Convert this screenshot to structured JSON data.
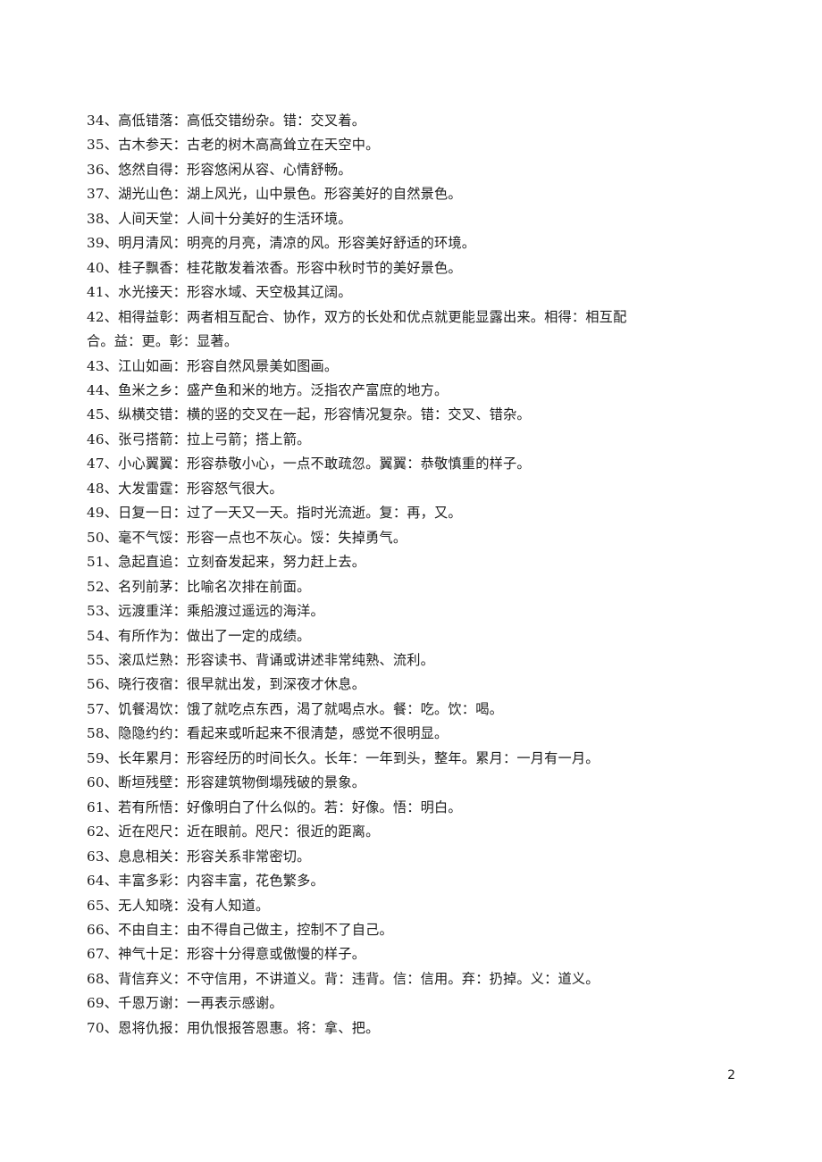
{
  "document": {
    "page_number": "2",
    "entries": [
      {
        "text": "34、高低错落：高低交错纷杂。错：交叉着。"
      },
      {
        "text": "35、古木参天：古老的树木高高耸立在天空中。"
      },
      {
        "text": "36、悠然自得：形容悠闲从容、心情舒畅。"
      },
      {
        "text": "37、湖光山色：湖上风光，山中景色。形容美好的自然景色。"
      },
      {
        "text": "38、人间天堂：人间十分美好的生活环境。"
      },
      {
        "text": "39、明月清风：明亮的月亮，清凉的风。形容美好舒适的环境。"
      },
      {
        "text": "40、桂子飘香：桂花散发着浓香。形容中秋时节的美好景色。"
      },
      {
        "text": "41、水光接天：形容水域、天空极其辽阔。"
      },
      {
        "text": "42、相得益彰：两者相互配合、协作，双方的长处和优点就更能显露出来。相得：相互配"
      },
      {
        "text": "合。益：更。彰：显著。",
        "wrapped": true
      },
      {
        "text": "43、江山如画：形容自然风景美如图画。"
      },
      {
        "text": "44、鱼米之乡：盛产鱼和米的地方。泛指农产富庶的地方。"
      },
      {
        "text": "45、纵横交错：横的竖的交叉在一起，形容情况复杂。错：交叉、错杂。"
      },
      {
        "text": "46、张弓搭箭：拉上弓箭；搭上箭。"
      },
      {
        "text": "47、小心翼翼：形容恭敬小心，一点不敢疏忽。翼翼：恭敬慎重的样子。"
      },
      {
        "text": "48、大发雷霆：形容怒气很大。"
      },
      {
        "text": "49、日复一日：过了一天又一天。指时光流逝。复：再，又。"
      },
      {
        "text": "50、毫不气馁：形容一点也不灰心。馁：失掉勇气。"
      },
      {
        "text": "51、急起直追：立刻奋发起来，努力赶上去。"
      },
      {
        "text": "52、名列前茅：比喻名次排在前面。"
      },
      {
        "text": "53、远渡重洋：乘船渡过遥远的海洋。"
      },
      {
        "text": "54、有所作为：做出了一定的成绩。"
      },
      {
        "text": "55、滚瓜烂熟：形容读书、背诵或讲述非常纯熟、流利。"
      },
      {
        "text": "56、晓行夜宿：很早就出发，到深夜才休息。"
      },
      {
        "text": "57、饥餐渴饮：饿了就吃点东西，渴了就喝点水。餐：吃。饮：喝。"
      },
      {
        "text": "58、隐隐约约：看起来或听起来不很清楚，感觉不很明显。"
      },
      {
        "text": "59、长年累月：形容经历的时间长久。长年：一年到头，整年。累月：一月有一月。"
      },
      {
        "text": "60、断垣残壁：形容建筑物倒塌残破的景象。"
      },
      {
        "text": "61、若有所悟：好像明白了什么似的。若：好像。悟：明白。"
      },
      {
        "text": "62、近在咫尺：近在眼前。咫尺：很近的距离。"
      },
      {
        "text": "63、息息相关：形容关系非常密切。"
      },
      {
        "text": "64、丰富多彩：内容丰富，花色繁多。"
      },
      {
        "text": "65、无人知晓：没有人知道。"
      },
      {
        "text": "66、不由自主：由不得自己做主，控制不了自己。"
      },
      {
        "text": "67、神气十足：形容十分得意或傲慢的样子。"
      },
      {
        "text": "68、背信弃义：不守信用，不讲道义。背：违背。信：信用。弃：扔掉。义：道义。"
      },
      {
        "text": "69、千恩万谢：一再表示感谢。"
      },
      {
        "text": "70、恩将仇报：用仇恨报答恩惠。将：拿、把。"
      }
    ]
  }
}
